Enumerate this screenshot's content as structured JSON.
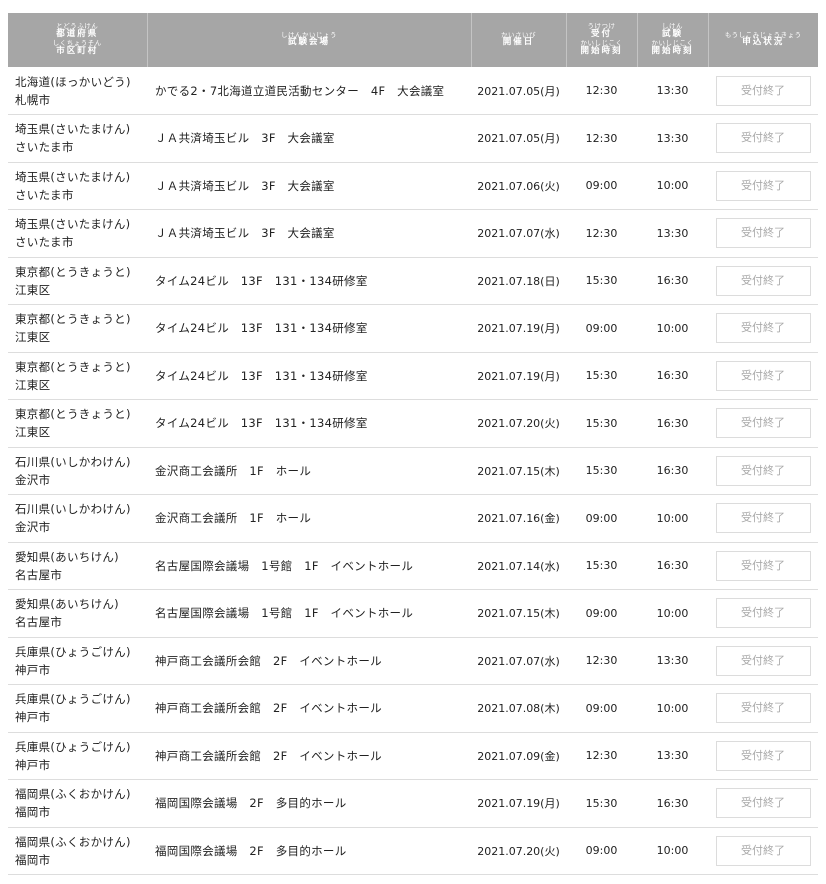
{
  "header": {
    "prefecture": {
      "ruby_1": "とどうふけん",
      "main_1": "都道府県",
      "ruby_2": "しくちょうそん",
      "main_2": "市区町村"
    },
    "venue": {
      "ruby": "しけんかいじょう",
      "main": "試験会場"
    },
    "date": {
      "ruby": "かいさいび",
      "main": "開催日"
    },
    "reception": {
      "ruby_1": "うけつけ",
      "main_1": "受付",
      "ruby_2": "かいしじこく",
      "main_2": "開始時刻"
    },
    "exam": {
      "ruby_1": "しけん",
      "main_1": "試験",
      "ruby_2": "かいしじこく",
      "main_2": "開始時刻"
    },
    "status": {
      "ruby": "もうしこみじょうきょう",
      "main": "申込状況"
    }
  },
  "rows": [
    {
      "pref": "北海道(ほっかいどう)",
      "city": "札幌市",
      "venue": "かでる2・7北海道立道民活動センター　4F　大会議室",
      "date": "2021.07.05(月)",
      "reception": "12:30",
      "exam": "13:30",
      "status": "受付終了"
    },
    {
      "pref": "埼玉県(さいたまけん)",
      "city": "さいたま市",
      "venue": "ＪＡ共済埼玉ビル　3F　大会議室",
      "date": "2021.07.05(月)",
      "reception": "12:30",
      "exam": "13:30",
      "status": "受付終了"
    },
    {
      "pref": "埼玉県(さいたまけん)",
      "city": "さいたま市",
      "venue": "ＪＡ共済埼玉ビル　3F　大会議室",
      "date": "2021.07.06(火)",
      "reception": "09:00",
      "exam": "10:00",
      "status": "受付終了"
    },
    {
      "pref": "埼玉県(さいたまけん)",
      "city": "さいたま市",
      "venue": "ＪＡ共済埼玉ビル　3F　大会議室",
      "date": "2021.07.07(水)",
      "reception": "12:30",
      "exam": "13:30",
      "status": "受付終了"
    },
    {
      "pref": "東京都(とうきょうと)",
      "city": "江東区",
      "venue": "タイム24ビル　13F　131・134研修室",
      "date": "2021.07.18(日)",
      "reception": "15:30",
      "exam": "16:30",
      "status": "受付終了"
    },
    {
      "pref": "東京都(とうきょうと)",
      "city": "江東区",
      "venue": "タイム24ビル　13F　131・134研修室",
      "date": "2021.07.19(月)",
      "reception": "09:00",
      "exam": "10:00",
      "status": "受付終了"
    },
    {
      "pref": "東京都(とうきょうと)",
      "city": "江東区",
      "venue": "タイム24ビル　13F　131・134研修室",
      "date": "2021.07.19(月)",
      "reception": "15:30",
      "exam": "16:30",
      "status": "受付終了"
    },
    {
      "pref": "東京都(とうきょうと)",
      "city": "江東区",
      "venue": "タイム24ビル　13F　131・134研修室",
      "date": "2021.07.20(火)",
      "reception": "15:30",
      "exam": "16:30",
      "status": "受付終了"
    },
    {
      "pref": "石川県(いしかわけん)",
      "city": "金沢市",
      "venue": "金沢商工会議所　1F　ホール",
      "date": "2021.07.15(木)",
      "reception": "15:30",
      "exam": "16:30",
      "status": "受付終了"
    },
    {
      "pref": "石川県(いしかわけん)",
      "city": "金沢市",
      "venue": "金沢商工会議所　1F　ホール",
      "date": "2021.07.16(金)",
      "reception": "09:00",
      "exam": "10:00",
      "status": "受付終了"
    },
    {
      "pref": "愛知県(あいちけん)",
      "city": "名古屋市",
      "venue": "名古屋国際会議場　1号館　1F　イベントホール",
      "date": "2021.07.14(水)",
      "reception": "15:30",
      "exam": "16:30",
      "status": "受付終了"
    },
    {
      "pref": "愛知県(あいちけん)",
      "city": "名古屋市",
      "venue": "名古屋国際会議場　1号館　1F　イベントホール",
      "date": "2021.07.15(木)",
      "reception": "09:00",
      "exam": "10:00",
      "status": "受付終了"
    },
    {
      "pref": "兵庫県(ひょうごけん)",
      "city": "神戸市",
      "venue": "神戸商工会議所会館　2F　イベントホール",
      "date": "2021.07.07(水)",
      "reception": "12:30",
      "exam": "13:30",
      "status": "受付終了"
    },
    {
      "pref": "兵庫県(ひょうごけん)",
      "city": "神戸市",
      "venue": "神戸商工会議所会館　2F　イベントホール",
      "date": "2021.07.08(木)",
      "reception": "09:00",
      "exam": "10:00",
      "status": "受付終了"
    },
    {
      "pref": "兵庫県(ひょうごけん)",
      "city": "神戸市",
      "venue": "神戸商工会議所会館　2F　イベントホール",
      "date": "2021.07.09(金)",
      "reception": "12:30",
      "exam": "13:30",
      "status": "受付終了"
    },
    {
      "pref": "福岡県(ふくおかけん)",
      "city": "福岡市",
      "venue": "福岡国際会議場　2F　多目的ホール",
      "date": "2021.07.19(月)",
      "reception": "15:30",
      "exam": "16:30",
      "status": "受付終了"
    },
    {
      "pref": "福岡県(ふくおかけん)",
      "city": "福岡市",
      "venue": "福岡国際会議場　2F　多目的ホール",
      "date": "2021.07.20(火)",
      "reception": "09:00",
      "exam": "10:00",
      "status": "受付終了"
    }
  ]
}
